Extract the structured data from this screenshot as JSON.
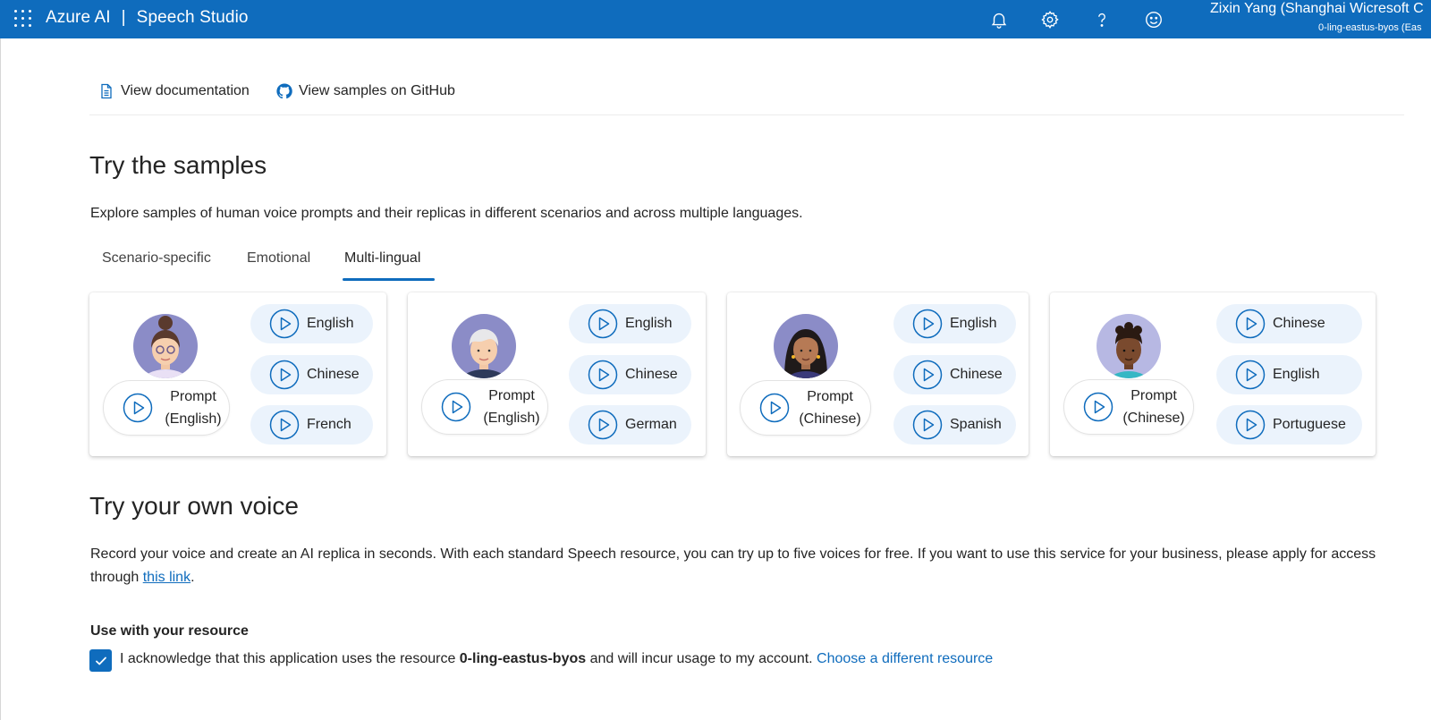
{
  "header": {
    "brand": "Azure AI",
    "separator": "|",
    "product": "Speech Studio",
    "icons": [
      "bell-icon",
      "gear-icon",
      "help-icon",
      "smiley-icon"
    ],
    "user_name": "Zixin Yang (Shanghai Wicresoft C",
    "user_resource": "0-ling-eastus-byos (Eas"
  },
  "links": {
    "documentation": "View documentation",
    "github": "View samples on GitHub"
  },
  "samples": {
    "title": "Try the samples",
    "description": "Explore samples of human voice prompts and their replicas in different scenarios and across multiple languages.",
    "tabs": [
      {
        "label": "Scenario-specific"
      },
      {
        "label": "Emotional"
      },
      {
        "label": "Multi-lingual",
        "active": true
      }
    ],
    "cards": [
      {
        "prompt_line1": "Prompt",
        "prompt_line2": "(English)",
        "languages": [
          "English",
          "Chinese",
          "French"
        ]
      },
      {
        "prompt_line1": "Prompt",
        "prompt_line2": "(English)",
        "languages": [
          "English",
          "Chinese",
          "German"
        ]
      },
      {
        "prompt_line1": "Prompt",
        "prompt_line2": "(Chinese)",
        "languages": [
          "English",
          "Chinese",
          "Spanish"
        ]
      },
      {
        "prompt_line1": "Prompt",
        "prompt_line2": "(Chinese)",
        "languages": [
          "Chinese",
          "English",
          "Portuguese"
        ]
      }
    ]
  },
  "own_voice": {
    "title": "Try your own voice",
    "description_part1": "Record your voice and create an AI replica in seconds. With each standard Speech resource, you can try up to five voices for free. If you want to use this service for your business, please apply for access through ",
    "link_text": "this link",
    "description_end": ".",
    "resource_label": "Use with your resource",
    "ack_part1": "I acknowledge that this application uses the resource ",
    "ack_resource": "0-ling-eastus-byos",
    "ack_part2": " and will incur usage to my account. ",
    "choose_link": "Choose a different resource",
    "checked": true
  },
  "colors": {
    "brand_blue": "#0f6cbd",
    "pill_bg": "#ebf3fc"
  }
}
